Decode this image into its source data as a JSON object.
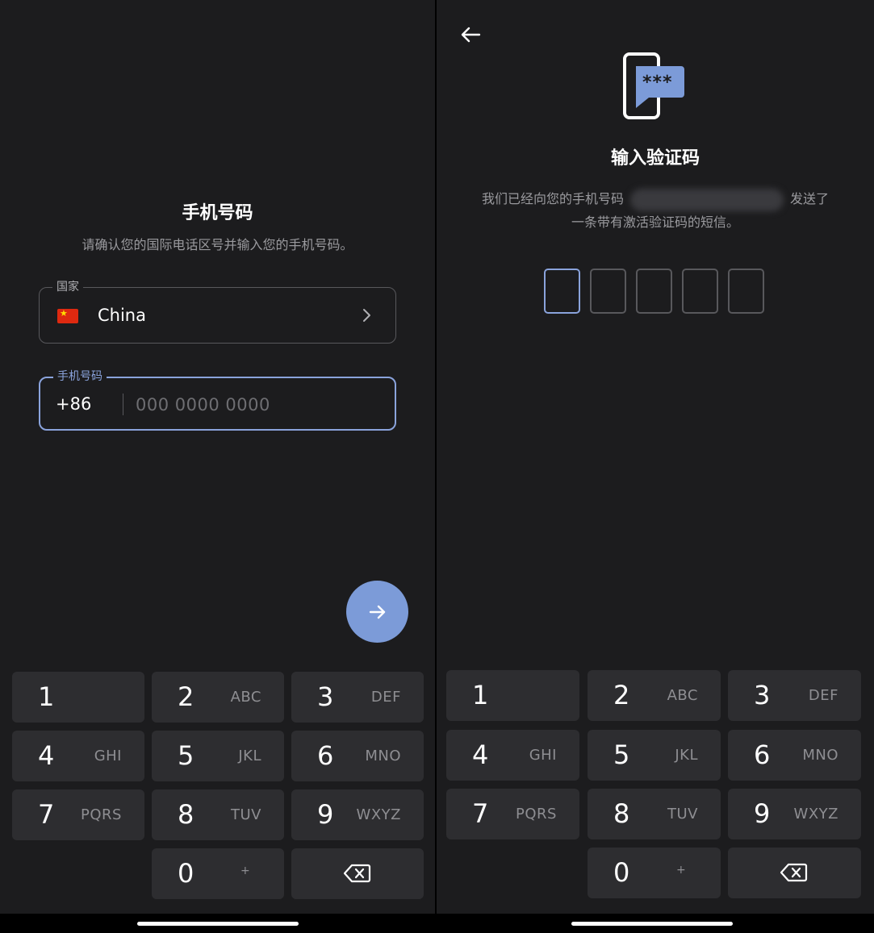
{
  "left_screen": {
    "title": "手机号码",
    "subtitle": "请确认您的国际电话区号并输入您的手机号码。",
    "country_field": {
      "legend": "国家",
      "value": "China",
      "flag_icon": "china-flag"
    },
    "phone_field": {
      "legend": "手机号码",
      "dial_code": "+86",
      "value": "",
      "placeholder": "000 0000 0000"
    },
    "next_button": {
      "icon": "arrow-right-icon",
      "color": "#7c9bd8"
    }
  },
  "right_screen": {
    "back_icon": "arrow-left-icon",
    "illustration_icon": "sms-code-icon",
    "illustration_text": "***",
    "title": "输入验证码",
    "message_part1": "我们已经向您的手机号码",
    "message_part2": "发送了",
    "message_line2": "一条带有激活验证码的短信。",
    "otp_digits": [
      "",
      "",
      "",
      "",
      ""
    ]
  },
  "keypad": {
    "keys": [
      {
        "digit": "1",
        "letters": ""
      },
      {
        "digit": "2",
        "letters": "ABC"
      },
      {
        "digit": "3",
        "letters": "DEF"
      },
      {
        "digit": "4",
        "letters": "GHI"
      },
      {
        "digit": "5",
        "letters": "JKL"
      },
      {
        "digit": "6",
        "letters": "MNO"
      },
      {
        "digit": "7",
        "letters": "PQRS"
      },
      {
        "digit": "8",
        "letters": "TUV"
      },
      {
        "digit": "9",
        "letters": "WXYZ"
      },
      {
        "digit": "0",
        "letters": "+"
      }
    ],
    "backspace_icon": "backspace-icon"
  },
  "colors": {
    "background": "#1c1c1e",
    "key_background": "#2d2d30",
    "accent": "#8aa3dc",
    "fab": "#7c9bd8"
  }
}
